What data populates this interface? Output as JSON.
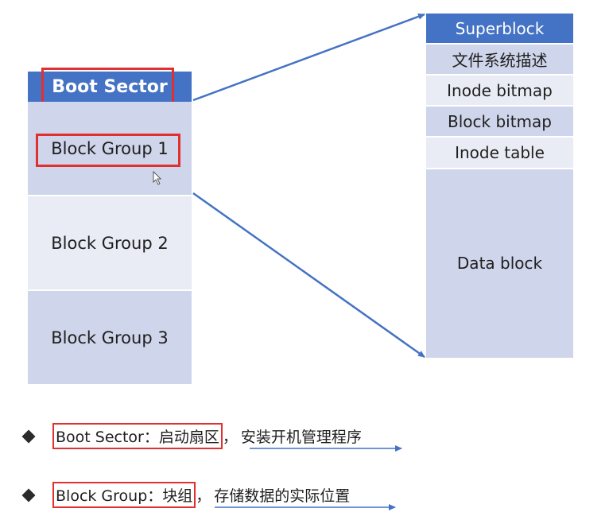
{
  "left_column": {
    "boot_sector": "Boot Sector",
    "groups": [
      "Block Group 1",
      "Block Group 2",
      "Block Group 3"
    ]
  },
  "right_column": {
    "superblock": "Superblock",
    "fs_desc": "文件系统描述",
    "inode_bitmap": "Inode bitmap",
    "block_bitmap": "Block bitmap",
    "inode_table": "Inode table",
    "data_block": "Data block"
  },
  "notes": [
    {
      "term": "Boot Sector：启动扇区",
      "sep": "，",
      "desc": "安装开机管理程序"
    },
    {
      "term": "Block Group：块组",
      "sep": "，",
      "desc": "存储数据的实际位置"
    }
  ],
  "colors": {
    "header_blue": "#4472c4",
    "cell_dark": "#cfd5ea",
    "cell_light": "#e9ebf5",
    "highlight_red": "#e03030",
    "arrow_blue": "#4472c4"
  }
}
